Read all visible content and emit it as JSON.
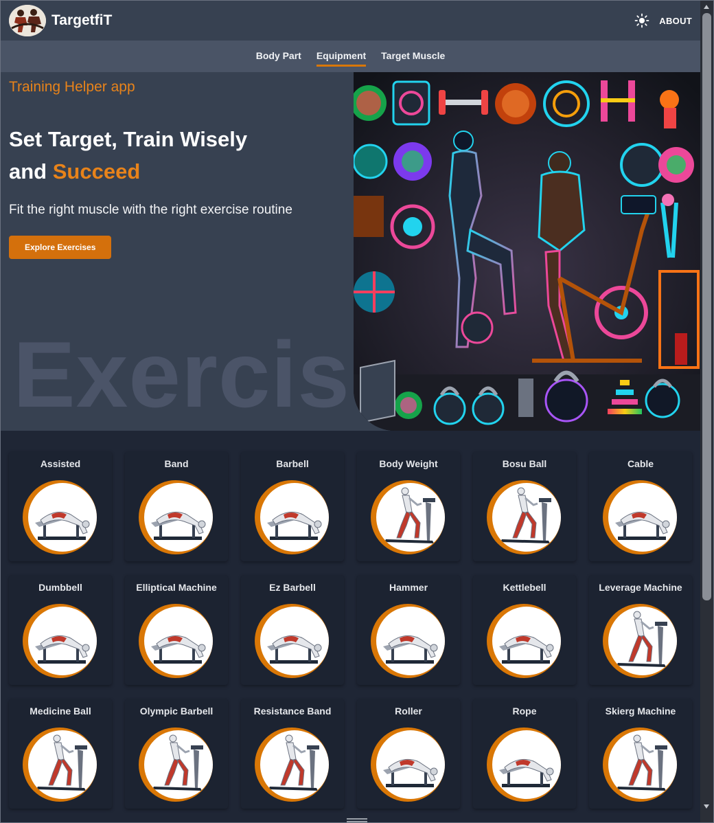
{
  "header": {
    "brand_name": "TargetfiT",
    "about_label": "ABOUT",
    "theme_icon": "sun-icon",
    "logo_icon": "athletes-logo"
  },
  "subnav": {
    "tabs": [
      {
        "label": "Body Part",
        "active": false
      },
      {
        "label": "Equipment",
        "active": true
      },
      {
        "label": "Target Muscle",
        "active": false
      }
    ]
  },
  "hero": {
    "eyebrow": "Training Helper app",
    "headline_line1": "Set Target, Train Wisely",
    "headline_and": "and",
    "headline_accent": "Succeed",
    "lead": "Fit the right muscle with the right exercise routine",
    "cta_label": "Explore Exercises",
    "watermark": "Exercise",
    "image_icon": "fitness-equipment-illustration"
  },
  "equipment": [
    {
      "label": "Assisted",
      "pose": "hyperextension"
    },
    {
      "label": "Band",
      "pose": "hyperextension"
    },
    {
      "label": "Barbell",
      "pose": "hyperextension"
    },
    {
      "label": "Body Weight",
      "pose": "treadmill"
    },
    {
      "label": "Bosu Ball",
      "pose": "treadmill"
    },
    {
      "label": "Cable",
      "pose": "hyperextension"
    },
    {
      "label": "Dumbbell",
      "pose": "hyperextension"
    },
    {
      "label": "Elliptical Machine",
      "pose": "hyperextension"
    },
    {
      "label": "Ez Barbell",
      "pose": "hyperextension"
    },
    {
      "label": "Hammer",
      "pose": "hyperextension"
    },
    {
      "label": "Kettlebell",
      "pose": "hyperextension"
    },
    {
      "label": "Leverage Machine",
      "pose": "treadmill"
    },
    {
      "label": "Medicine Ball",
      "pose": "treadmill"
    },
    {
      "label": "Olympic Barbell",
      "pose": "treadmill"
    },
    {
      "label": "Resistance Band",
      "pose": "treadmill"
    },
    {
      "label": "Roller",
      "pose": "hyperextension"
    },
    {
      "label": "Rope",
      "pose": "hyperextension"
    },
    {
      "label": "Skierg Machine",
      "pose": "treadmill"
    }
  ],
  "colors": {
    "accent": "#d97706",
    "header_bg": "#374151",
    "subnav_bg": "#4a5466",
    "page_bg": "#1f2635"
  }
}
